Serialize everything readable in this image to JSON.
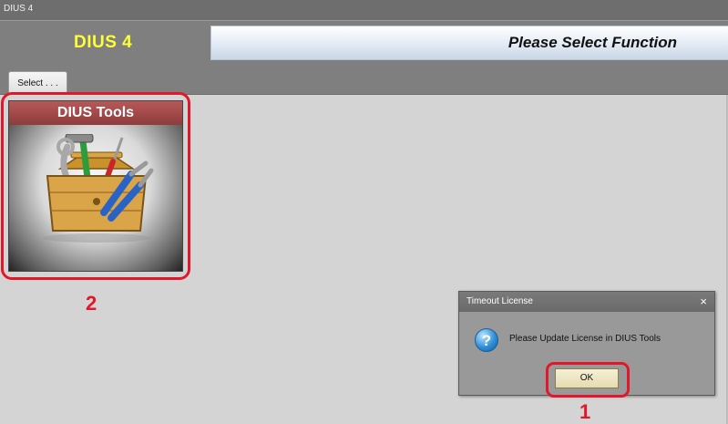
{
  "window": {
    "title": "DIUS 4"
  },
  "header": {
    "app_name": "DIUS 4",
    "function_prompt": "Please Select Function",
    "tab_label": "Select . . ."
  },
  "tiles": [
    {
      "label": "DIUS Tools",
      "icon": "toolbox-icon"
    }
  ],
  "annotations": {
    "marker_1": "1",
    "marker_2": "2"
  },
  "dialog": {
    "title": "Timeout License",
    "close_glyph": "×",
    "icon": "question-icon",
    "icon_glyph": "?",
    "message": "Please Update License in DIUS Tools",
    "ok_label": "OK"
  },
  "colors": {
    "accent_yellow": "#ffff33",
    "highlight_red": "#e0182a",
    "tile_title_bar": "#a04a4a"
  }
}
